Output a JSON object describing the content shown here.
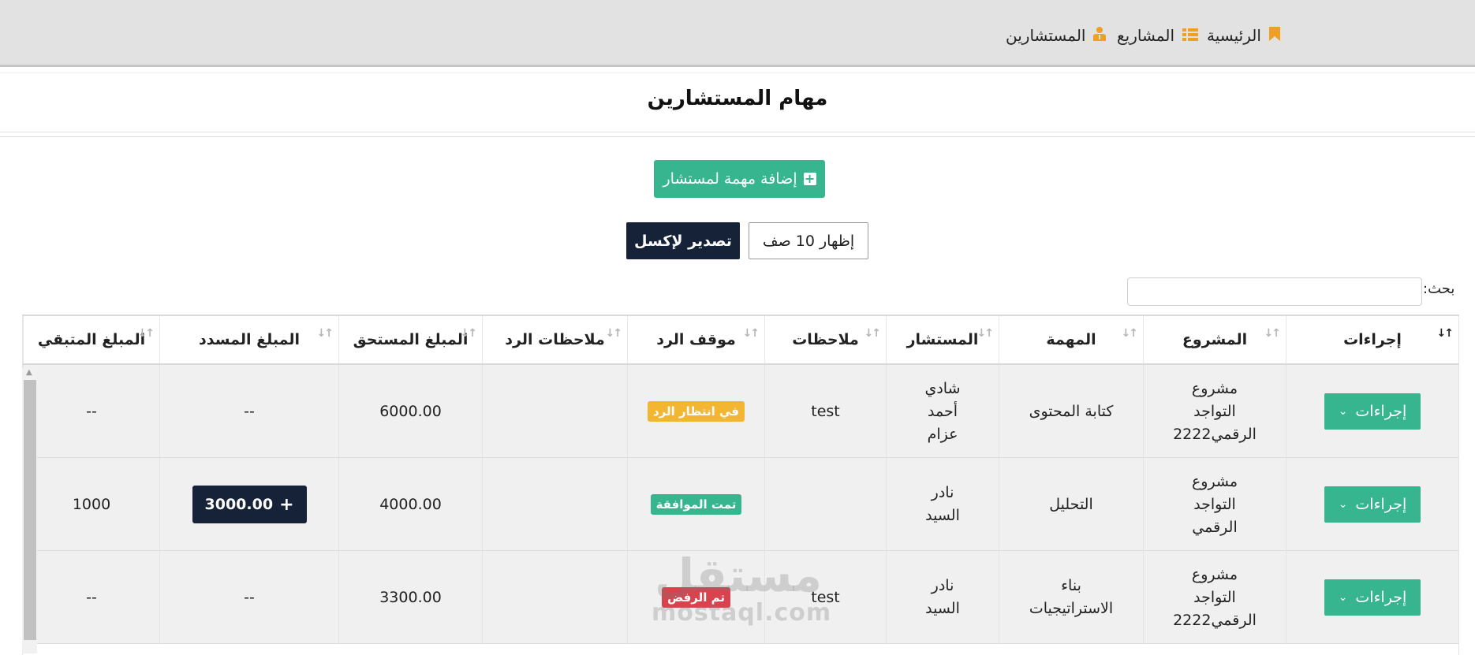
{
  "nav": {
    "items": [
      {
        "label": "الرئيسية",
        "icon": "bookmark-icon"
      },
      {
        "label": "المشاريع",
        "icon": "list-icon"
      },
      {
        "label": "المستشارين",
        "icon": "user-tie-icon"
      }
    ],
    "icon_color": "#f0a020"
  },
  "page": {
    "title": "مهام المستشارين",
    "add_button": "إضافة مهمة لمستشار",
    "export_button": "تصدير لإكسل",
    "rows_button": "إظهار 10 صف",
    "search_label": "بحث:",
    "search_value": ""
  },
  "table": {
    "headers": [
      "إجراءات",
      "المشروع",
      "المهمة",
      "المستشار",
      "ملاحظات",
      "موقف الرد",
      "ملاحظات الرد",
      "المبلغ المستحق",
      "المبلغ المسدد",
      "المبلغ المتبقي"
    ],
    "rows": [
      {
        "action": "إجراءات",
        "project": "مشروع التواجد الرقمي2222",
        "task": "كتابة المحتوى",
        "consultant": "شادي أحمد عزام",
        "notes": "test",
        "status": "في انتظار الرد",
        "status_color": "#f2b632",
        "reply_notes": "",
        "due": "6000.00",
        "paid": "--",
        "remaining": "--"
      },
      {
        "action": "إجراءات",
        "project": "مشروع التواجد الرقمي",
        "task": "التحليل",
        "consultant": "نادر السيد",
        "notes": "",
        "status": "تمت الموافقة",
        "status_color": "#36b58f",
        "reply_notes": "",
        "due": "4000.00",
        "paid": "3000.00",
        "remaining": "1000"
      },
      {
        "action": "إجراءات",
        "project": "مشروع التواجد الرقمي2222",
        "task": "بناء الاستراتيجيات",
        "consultant": "نادر السيد",
        "notes": "test",
        "status": "تم الرفض",
        "status_color": "#d9434e",
        "reply_notes": "",
        "due": "3300.00",
        "paid": "--",
        "remaining": "--"
      }
    ]
  },
  "watermark": {
    "arabic": "مستقل",
    "latin": "mostaql.com"
  },
  "colors": {
    "accent_green": "#36b58f",
    "navy": "#152238",
    "nav_bg": "#e2e2e2"
  }
}
